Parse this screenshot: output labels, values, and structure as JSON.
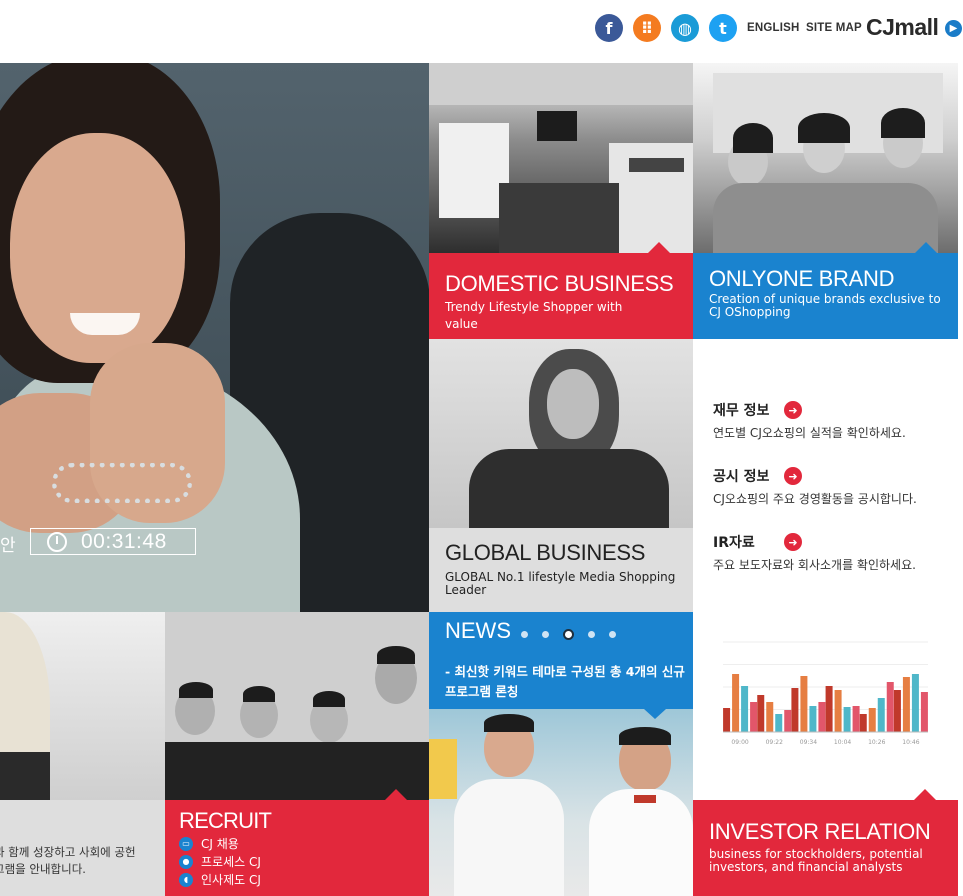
{
  "header": {
    "social": [
      {
        "icon": "facebook-icon",
        "glyph": "f",
        "color": "#3b5998"
      },
      {
        "icon": "flickr-icon",
        "glyph": "⠿",
        "color": "#f47b20"
      },
      {
        "icon": "globe-icon",
        "glyph": "◍",
        "color": "#1a9bd7"
      },
      {
        "icon": "twitter-icon",
        "glyph": "t",
        "color": "#1da1f2"
      }
    ],
    "english_label": "ENGLISH",
    "sitemap_label": "SITE MAP",
    "cjmall_logo": {
      "cj": "CJ",
      "mall": "mall"
    }
  },
  "hero": {
    "timer_label": "안",
    "timer_value": "00:31:48",
    "dots_active_index": 2
  },
  "tiles": {
    "domestic": {
      "title": "DOMESTIC BUSINESS",
      "subtitle": "Trendy Lifestyle Shopper with value",
      "color": "#e2283c"
    },
    "onlyone": {
      "title": "ONLYONE BRAND",
      "subtitle": "Creation of unique brands exclusive to CJ OShopping",
      "color": "#1a83cf"
    },
    "global": {
      "title": "GLOBAL  BUSINESS",
      "subtitle": "GLOBAL No.1 lifestyle Media Shopping Leader"
    },
    "recruit": {
      "title": "RECRUIT",
      "items": [
        "CJ 채용",
        "프로세스 CJ",
        "인사제도 CJ"
      ]
    },
    "investor": {
      "title": "INVESTOR RELATION",
      "subtitle": "business for stockholders, potential investors, and financial analysts"
    },
    "left_bottom_text": "과 함께 성장하고 사회에 공헌\n그램을 안내합니다."
  },
  "info": {
    "items": [
      {
        "title": "재무 정보",
        "text": "연도별 CJ오쇼핑의 실적을 확인하세요."
      },
      {
        "title": "공시 정보",
        "text": "CJ오쇼핑의 주요 경영활동을 공시합니다."
      },
      {
        "title": "IR자료",
        "text": "주요 보도자료와 회사소개를 확인하세요."
      }
    ]
  },
  "news": {
    "title": "NEWS",
    "dots_active_index": 2,
    "text": "- 최신핫 키워드 테마로 구성된 총 4개의 신규 프로그램 론칭"
  },
  "chart_data": {
    "type": "bar",
    "categories": [
      "09:00",
      "09:22",
      "09:34",
      "10:04",
      "10:26",
      "10:46"
    ],
    "series": [
      {
        "values": [
          24,
          37,
          44,
          46,
          18,
          42
        ]
      },
      {
        "values": [
          58,
          30,
          56,
          42,
          24,
          55
        ]
      },
      {
        "values": [
          46,
          18,
          26,
          25,
          34,
          58
        ]
      },
      {
        "values": [
          30,
          22,
          30,
          26,
          50,
          40
        ]
      }
    ],
    "colors": [
      "#c0392b",
      "#e67e42",
      "#4fb7c9",
      "#e2566a"
    ],
    "ylim": [
      0,
      90
    ],
    "xlabel": "",
    "ylabel": "",
    "title": ""
  }
}
